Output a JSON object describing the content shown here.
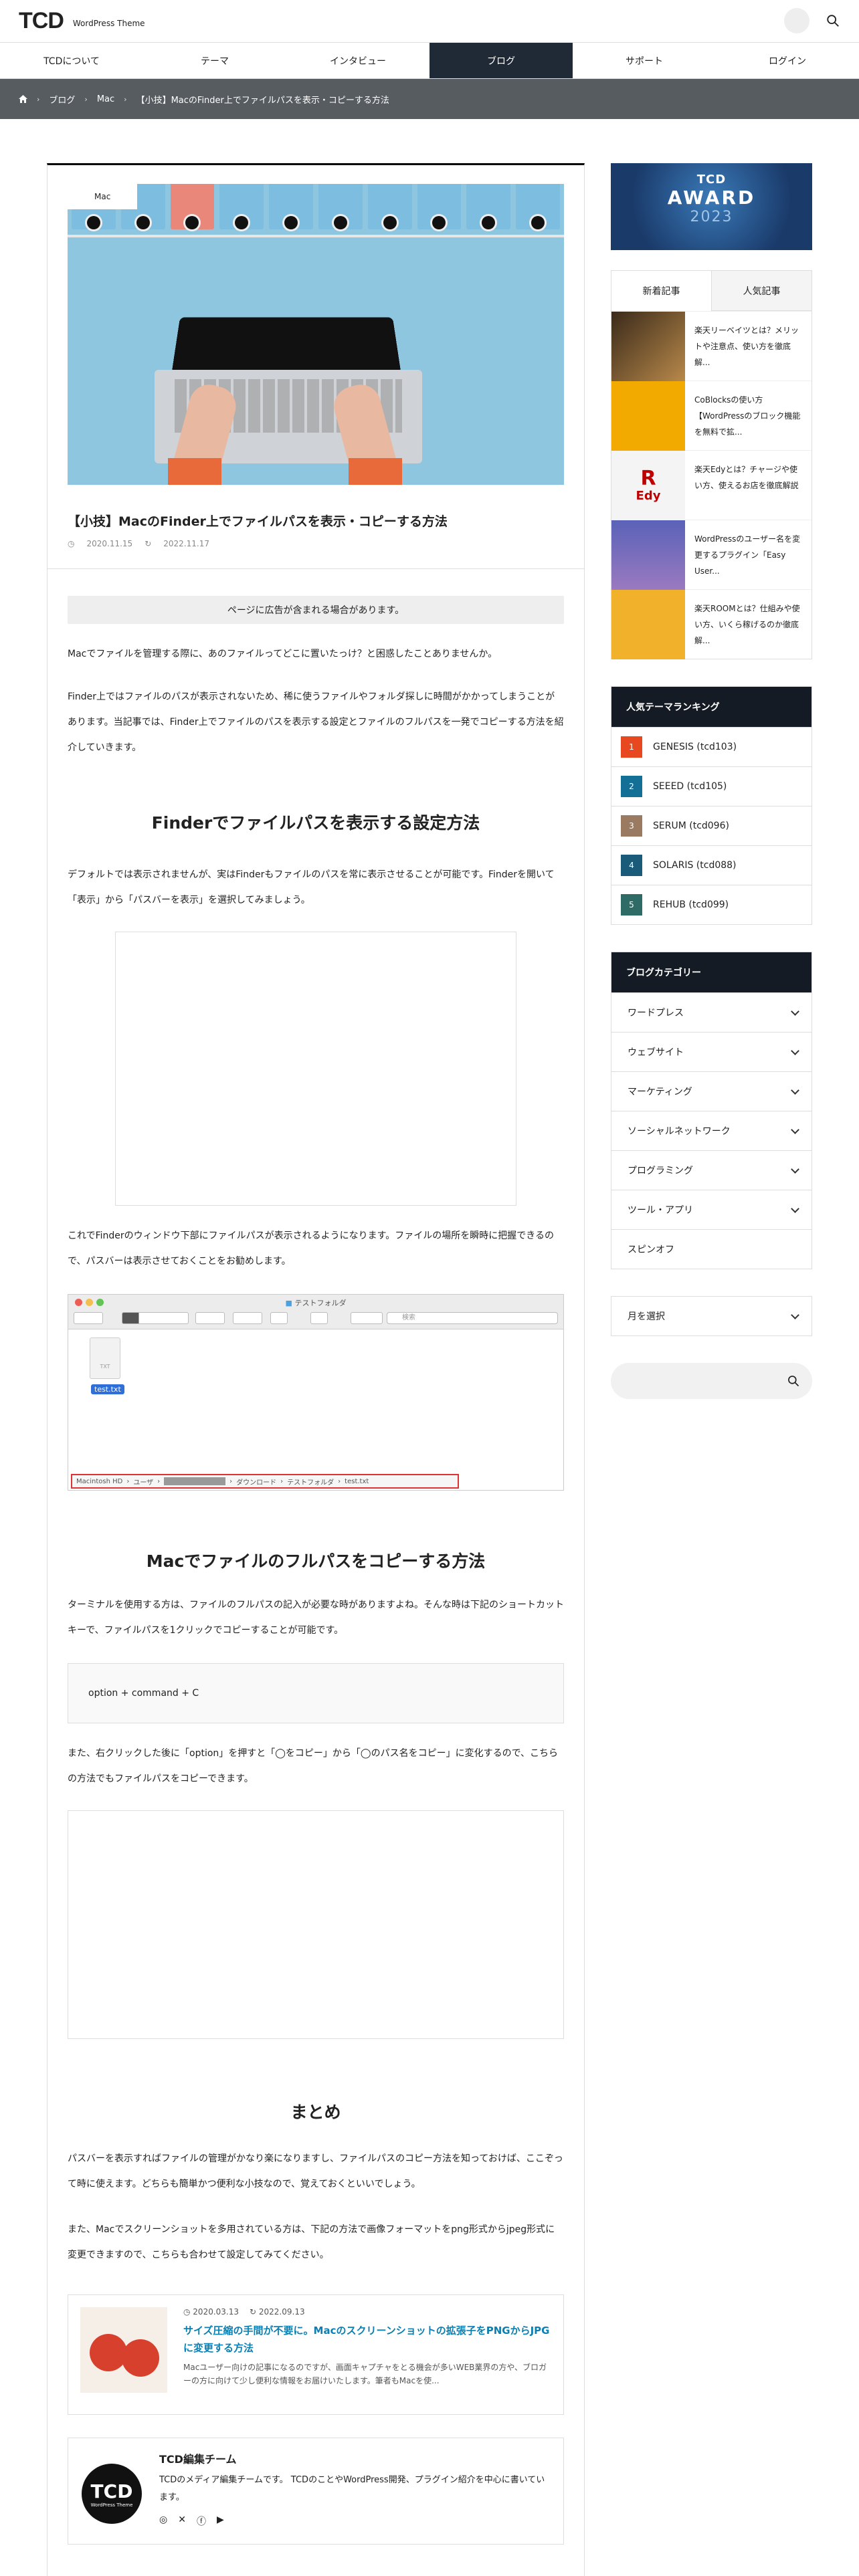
{
  "header": {
    "logo": "TCD",
    "logo_sub": "WordPress Theme"
  },
  "nav": [
    "TCDについて",
    "テーマ",
    "インタビュー",
    "ブログ",
    "サポート",
    "ログイン"
  ],
  "breadcrumb": [
    "ブログ",
    "Mac",
    "【小技】MacのFinder上でファイルパスを表示・コピーする方法"
  ],
  "post": {
    "category": "Mac",
    "title": "【小技】MacのFinder上でファイルパスを表示・コピーする方法",
    "published": "2020.11.15",
    "updated": "2022.11.17",
    "ad_note": "ページに広告が含まれる場合があります。",
    "p1": "Macでファイルを管理する際に、あのファイルってどこに置いたっけ？と困惑したことありませんか。",
    "p2": "Finder上ではファイルのパスが表示されないため、稀に使うファイルやフォルダ探しに時間がかかってしまうことがあります。当記事では、Finder上でファイルのパスを表示する設定とファイルのフルパスを一発でコピーする方法を紹介していきます。",
    "h2_1": "Finderでファイルパスを表示する設定方法",
    "p3": "デフォルトでは表示されませんが、実はFinderもファイルのパスを常に表示させることが可能です。Finderを開いて「表示」から「パスバーを表示」を選択してみましょう。",
    "p4": "これでFinderのウィンドウ下部にファイルパスが表示されるようになります。ファイルの場所を瞬時に把握できるので、パスバーは表示させておくことをお勧めします。",
    "finder": {
      "title": "テストフォルダ",
      "search_placeholder": "検索",
      "file_type": "TXT",
      "file_name": "test.txt",
      "path": [
        "Macintosh HD",
        "ユーザ",
        "ダウンロード",
        "テストフォルダ",
        "test.txt"
      ]
    },
    "h2_2": "Macでファイルのフルパスをコピーする方法",
    "p5": "ターミナルを使用する方は、ファイルのフルパスの記入が必要な時がありますよね。そんな時は下記のショートカットキーで、ファイルパスを1クリックでコピーすることが可能です。",
    "shortcut": "option + command + C",
    "p6": "また、右クリックした後に「option」を押すと「◯をコピー」から「◯のパス名をコピー」に変化するので、こちらの方法でもファイルパスをコピーできます。",
    "h2_3": "まとめ",
    "p7": "パスバーを表示すればファイルの管理がかなり楽になりますし、ファイルパスのコピー方法を知っておけば、ここぞって時に使えます。どちらも簡単かつ便利な小技なので、覚えておくといいでしょう。",
    "p8": "また、Macでスクリーンショットを多用されている方は、下記の方法で画像フォーマットをpng形式からjpeg形式に変更できますので、こちらも合わせて設定してみてください。"
  },
  "related": {
    "published": "2020.03.13",
    "updated": "2022.09.13",
    "title": "サイズ圧縮の手間が不要に。Macのスクリーンショットの拡張子をPNGからJPGに変更する方法",
    "desc": "Macユーザー向けの記事になるのですが、画面キャプチャをとる機会が多いWEB業界の方や、ブロガーの方に向けて少し便利な情報をお届けいたします。筆者もMacを使..."
  },
  "author": {
    "avatar_text": "TCD",
    "avatar_sub": "WordPress Theme",
    "name": "TCD編集チーム",
    "desc": "TCDのメディア編集チームです。 TCDのことやWordPress開発、プラグイン紹介を中心に書いています。"
  },
  "sidebar": {
    "banner": {
      "line1": "TCD",
      "line2": "AWARD",
      "line3": "2023"
    },
    "tabs": [
      "新着記事",
      "人気記事"
    ],
    "recent": [
      "楽天リーベイツとは？メリットや注意点、使い方を徹底解...",
      "CoBlocksの使い方【WordPressのブロック機能を無料で拡...",
      "楽天Edyとは？チャージや使い方、使えるお店を徹底解説",
      "WordPressのユーザー名を変更するプラグイン「Easy User...",
      "楽天ROOMとは？仕組みや使い方、いくら稼げるのか徹底解..."
    ],
    "edy_logo": "R",
    "edy_text": "Edy",
    "ranking_title": "人気テーマランキング",
    "ranking": [
      {
        "num": "1",
        "name": "GENESIS (tcd103)",
        "color": "#e8481f"
      },
      {
        "num": "2",
        "name": "SEEED (tcd105)",
        "color": "#146f96"
      },
      {
        "num": "3",
        "name": "SERUM (tcd096)",
        "color": "#9a7b62"
      },
      {
        "num": "4",
        "name": "SOLARIS (tcd088)",
        "color": "#1a5b7a"
      },
      {
        "num": "5",
        "name": "REHUB (tcd099)",
        "color": "#2e6a66"
      }
    ],
    "category_title": "ブログカテゴリー",
    "categories": [
      "ワードプレス",
      "ウェブサイト",
      "マーケティング",
      "ソーシャルネットワーク",
      "プログラミング",
      "ツール・アプリ",
      "スピンオフ"
    ],
    "month_select": "月を選択"
  }
}
